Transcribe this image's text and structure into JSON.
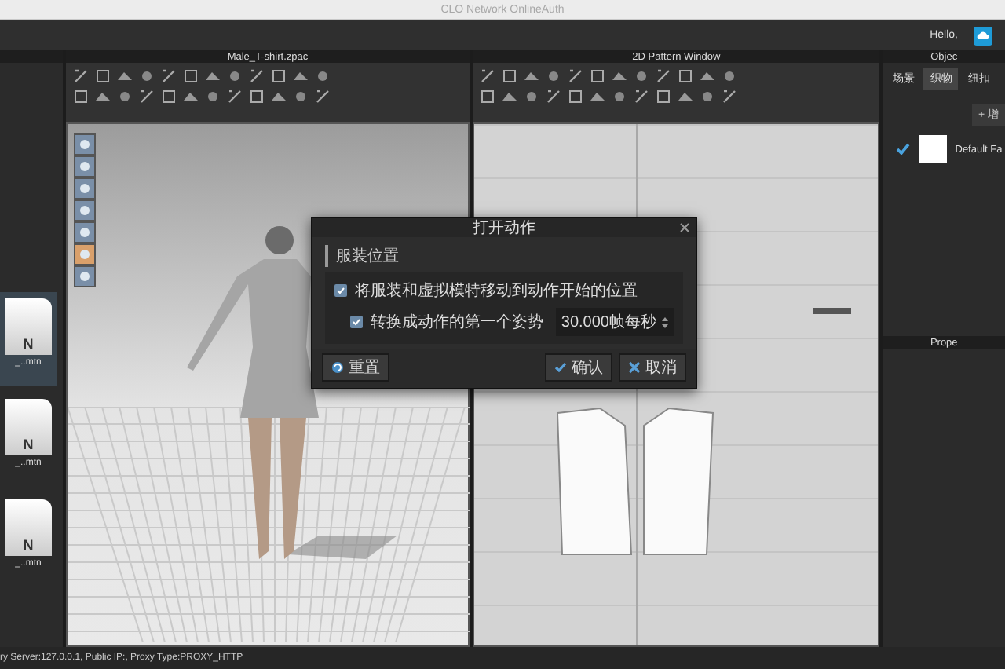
{
  "window": {
    "title": "CLO Network OnlineAuth"
  },
  "top_bar": {
    "greeting": "Hello,"
  },
  "library": {
    "files": [
      {
        "glyph": "N",
        "name": "_..mtn",
        "selected": true
      },
      {
        "glyph": "N",
        "name": "_..mtn",
        "selected": false
      },
      {
        "glyph": "N",
        "name": "_..mtn",
        "selected": false
      }
    ]
  },
  "view_3d": {
    "title": "Male_T-shirt.zpac"
  },
  "pattern_window": {
    "title": "2D Pattern Window"
  },
  "object_panel": {
    "title": "Objec",
    "tabs": [
      {
        "label": "场景",
        "selected": false
      },
      {
        "label": "织物",
        "selected": true
      },
      {
        "label": "纽扣",
        "selected": false
      }
    ],
    "add_button": "+ 增",
    "fabrics": [
      {
        "name": "Default Fa",
        "checked": true
      }
    ]
  },
  "property_panel": {
    "title": "Prope"
  },
  "dialog": {
    "title": "打开动作",
    "section": "服装位置",
    "options": [
      {
        "label": "将服装和虚拟模特移动到动作开始的位置",
        "checked": true,
        "children": [
          {
            "label": "转换成动作的第一个姿势",
            "checked": true,
            "value": "30.000帧每秒"
          }
        ]
      }
    ],
    "buttons": [
      {
        "label": "重置",
        "kind": "reset"
      },
      {
        "label": "确认",
        "kind": "confirm"
      },
      {
        "label": "取消",
        "kind": "cancel"
      }
    ]
  },
  "status_bar": {
    "text": "ry Server:127.0.0.1, Public IP:, Proxy Type:PROXY_HTTP"
  }
}
